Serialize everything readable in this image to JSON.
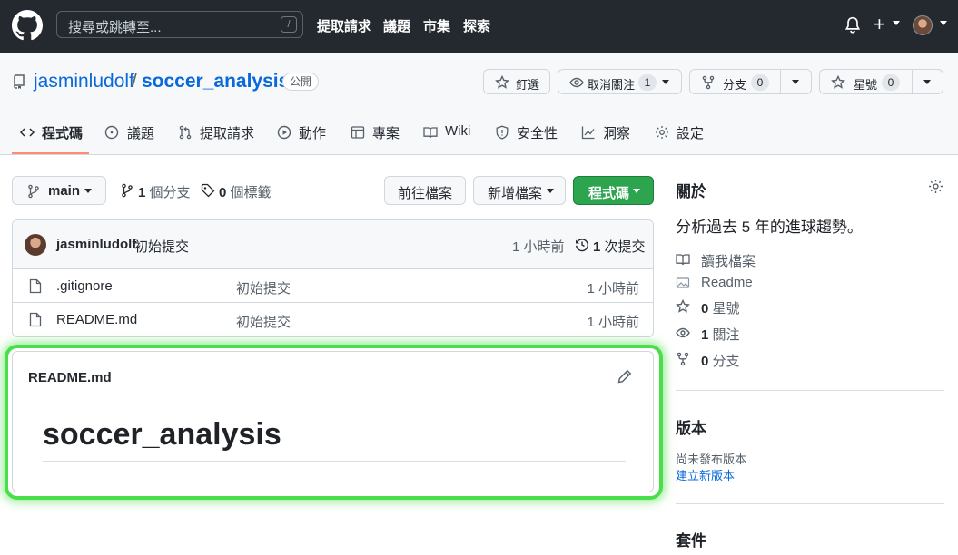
{
  "header": {
    "search_placeholder": "搜尋或跳轉至...",
    "search_shortcut": "/",
    "nav": [
      "提取請求",
      "議題",
      "市集",
      "探索"
    ]
  },
  "repo": {
    "owner": "jasminludolf",
    "separator": "/",
    "name": "soccer_analysis",
    "visibility": "公開",
    "buttons": {
      "pin": "釘選",
      "watch": "取消關注",
      "watch_count": "1",
      "fork": "分支",
      "fork_count": "0",
      "star": "星號",
      "star_count": "0"
    },
    "tabs": [
      "程式碼",
      "議題",
      "提取請求",
      "動作",
      "專案",
      "Wiki",
      "安全性",
      "洞察",
      "設定"
    ]
  },
  "toolbar": {
    "branch": "main",
    "branches_count": "1",
    "branches_label": "個分支",
    "tags_count": "0",
    "tags_label": "個標籤",
    "goto_file": "前往檔案",
    "add_file": "新增檔案",
    "code_button": "程式碼"
  },
  "commit": {
    "author": "jasminludolf",
    "message": "初始提交",
    "time": "1 小時前",
    "commits_count": "1",
    "commits_label": "次提交"
  },
  "files": [
    {
      "name": ".gitignore",
      "message": "初始提交",
      "time": "1 小時前"
    },
    {
      "name": "README.md",
      "message": "初始提交",
      "time": "1 小時前"
    }
  ],
  "readme": {
    "filename": "README.md",
    "heading": "soccer_analysis"
  },
  "sidebar": {
    "about_title": "關於",
    "description": "分析過去 5 年的進球趨勢。",
    "readme_label": "讀我檔案",
    "readme_link": "Readme",
    "stars_count": "0",
    "stars_label": "星號",
    "watching_count": "1",
    "watching_label": "關注",
    "forks_count": "0",
    "forks_label": "分支",
    "releases_title": "版本",
    "no_releases": "尚未發布版本",
    "create_release": "建立新版本",
    "packages_title": "套件"
  },
  "colors": {
    "header_bg": "#24292f",
    "link": "#0969da",
    "primary_button": "#2da44e",
    "active_tab": "#fd8c73",
    "highlight": "#4ade4a"
  }
}
